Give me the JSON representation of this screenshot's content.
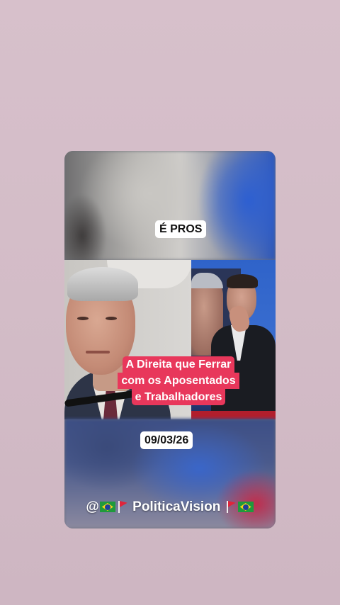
{
  "video": {
    "top_label": "É PROS",
    "title_lines": [
      "A Direita que Ferrar",
      "com os Aposentados",
      "e Trabalhadores"
    ],
    "date": "09/03/26",
    "handle": {
      "prefix": "@",
      "name": "PoliticaVision"
    }
  },
  "colors": {
    "page_background": "#d7c0cb",
    "title_highlight": "#e8375b"
  },
  "icons": [
    "brazil-flag-icon",
    "red-flag-icon"
  ]
}
